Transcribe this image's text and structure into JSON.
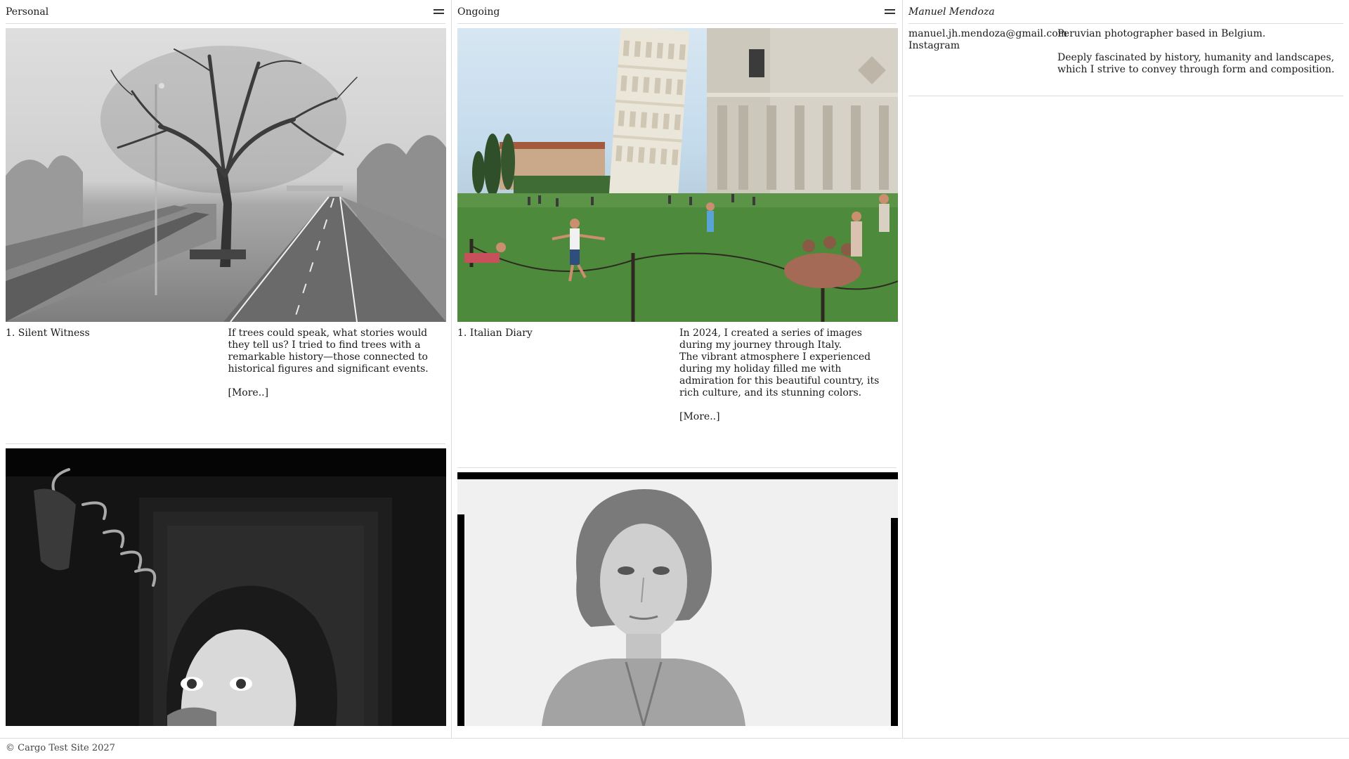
{
  "columns": {
    "personal": {
      "title": "Personal",
      "projects": [
        {
          "title": "1. Silent Witness",
          "description": "If trees could speak, what stories would they tell us? I tried to find trees with a remarkable history—those connected to historical figures and significant events.",
          "more": "[More..]"
        }
      ]
    },
    "ongoing": {
      "title": "Ongoing",
      "projects": [
        {
          "title": "1. Italian Diary",
          "description_1": "In 2024, I created a series of images during my journey through Italy.",
          "description_2": "The vibrant atmosphere I experienced during my holiday filled me with admiration for this beautiful country, its rich culture, and its stunning colors.",
          "more": "[More..]"
        }
      ]
    },
    "about": {
      "title": "Manuel Mendoza",
      "email": "manuel.jh.mendoza@gmail.com",
      "instagram": "Instagram",
      "bio_1": "Peruvian photographer based in Belgium.",
      "bio_2": "Deeply fascinated by history, humanity and landscapes, which I strive to convey through form and composition."
    }
  },
  "icons": {
    "menu": "menu-icon"
  },
  "footer": {
    "text": "© Cargo Test Site 2027"
  },
  "colors": {
    "text": "#1a1a1a",
    "divider": "#dcdcdc",
    "background": "#ffffff"
  }
}
